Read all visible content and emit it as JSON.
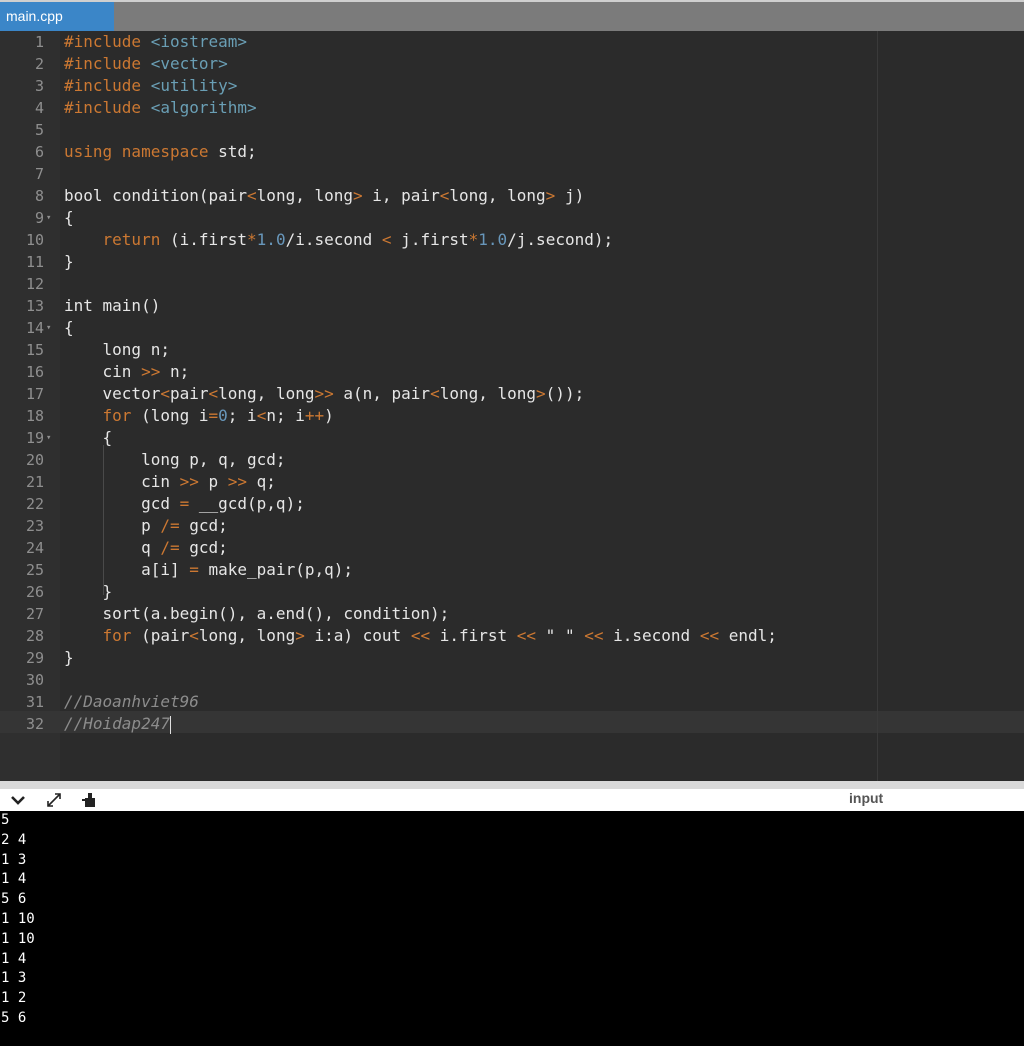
{
  "tab": {
    "label": "main.cpp"
  },
  "editor": {
    "lines": [
      {
        "n": "1",
        "fold": false,
        "tokens": [
          {
            "t": "#include ",
            "c": "kw"
          },
          {
            "t": "<iostream>",
            "c": "str"
          }
        ]
      },
      {
        "n": "2",
        "fold": false,
        "tokens": [
          {
            "t": "#include ",
            "c": "kw"
          },
          {
            "t": "<vector>",
            "c": "str"
          }
        ]
      },
      {
        "n": "3",
        "fold": false,
        "tokens": [
          {
            "t": "#include ",
            "c": "kw"
          },
          {
            "t": "<utility>",
            "c": "str"
          }
        ]
      },
      {
        "n": "4",
        "fold": false,
        "tokens": [
          {
            "t": "#include ",
            "c": "kw"
          },
          {
            "t": "<algorithm>",
            "c": "str"
          }
        ]
      },
      {
        "n": "5",
        "fold": false,
        "tokens": []
      },
      {
        "n": "6",
        "fold": false,
        "tokens": [
          {
            "t": "using ",
            "c": "kw"
          },
          {
            "t": "namespace ",
            "c": "kw"
          },
          {
            "t": "std;",
            "c": ""
          }
        ]
      },
      {
        "n": "7",
        "fold": false,
        "tokens": []
      },
      {
        "n": "8",
        "fold": false,
        "tokens": [
          {
            "t": "bool condition(pair",
            "c": ""
          },
          {
            "t": "<",
            "c": "op"
          },
          {
            "t": "long, long",
            "c": ""
          },
          {
            "t": ">",
            "c": "op"
          },
          {
            "t": " i, pair",
            "c": ""
          },
          {
            "t": "<",
            "c": "op"
          },
          {
            "t": "long, long",
            "c": ""
          },
          {
            "t": ">",
            "c": "op"
          },
          {
            "t": " j)",
            "c": ""
          }
        ]
      },
      {
        "n": "9",
        "fold": true,
        "tokens": [
          {
            "t": "{",
            "c": ""
          }
        ]
      },
      {
        "n": "10",
        "fold": false,
        "tokens": [
          {
            "t": "    ",
            "c": ""
          },
          {
            "t": "return",
            "c": "kw"
          },
          {
            "t": " (i.first",
            "c": ""
          },
          {
            "t": "*",
            "c": "op"
          },
          {
            "t": "1.0",
            "c": "num"
          },
          {
            "t": "/i.second ",
            "c": ""
          },
          {
            "t": "<",
            "c": "op"
          },
          {
            "t": " j.first",
            "c": ""
          },
          {
            "t": "*",
            "c": "op"
          },
          {
            "t": "1.0",
            "c": "num"
          },
          {
            "t": "/j.second);",
            "c": ""
          }
        ]
      },
      {
        "n": "11",
        "fold": false,
        "tokens": [
          {
            "t": "}",
            "c": ""
          }
        ]
      },
      {
        "n": "12",
        "fold": false,
        "tokens": []
      },
      {
        "n": "13",
        "fold": false,
        "tokens": [
          {
            "t": "int main()",
            "c": ""
          }
        ]
      },
      {
        "n": "14",
        "fold": true,
        "tokens": [
          {
            "t": "{",
            "c": ""
          }
        ]
      },
      {
        "n": "15",
        "fold": false,
        "tokens": [
          {
            "t": "    long n;",
            "c": ""
          }
        ]
      },
      {
        "n": "16",
        "fold": false,
        "tokens": [
          {
            "t": "    cin ",
            "c": ""
          },
          {
            "t": ">>",
            "c": "op"
          },
          {
            "t": " n;",
            "c": ""
          }
        ]
      },
      {
        "n": "17",
        "fold": false,
        "tokens": [
          {
            "t": "    vector",
            "c": ""
          },
          {
            "t": "<",
            "c": "op"
          },
          {
            "t": "pair",
            "c": ""
          },
          {
            "t": "<",
            "c": "op"
          },
          {
            "t": "long, long",
            "c": ""
          },
          {
            "t": ">>",
            "c": "op"
          },
          {
            "t": " a(n, pair",
            "c": ""
          },
          {
            "t": "<",
            "c": "op"
          },
          {
            "t": "long, long",
            "c": ""
          },
          {
            "t": ">",
            "c": "op"
          },
          {
            "t": "());",
            "c": ""
          }
        ]
      },
      {
        "n": "18",
        "fold": false,
        "tokens": [
          {
            "t": "    ",
            "c": ""
          },
          {
            "t": "for",
            "c": "kw"
          },
          {
            "t": " (long i",
            "c": ""
          },
          {
            "t": "=",
            "c": "op"
          },
          {
            "t": "0",
            "c": "num"
          },
          {
            "t": "; i",
            "c": ""
          },
          {
            "t": "<",
            "c": "op"
          },
          {
            "t": "n; i",
            "c": ""
          },
          {
            "t": "++",
            "c": "op"
          },
          {
            "t": ")",
            "c": ""
          }
        ]
      },
      {
        "n": "19",
        "fold": true,
        "tokens": [
          {
            "t": "    {",
            "c": ""
          }
        ]
      },
      {
        "n": "20",
        "fold": false,
        "tokens": [
          {
            "t": "        long p, q, gcd;",
            "c": ""
          }
        ]
      },
      {
        "n": "21",
        "fold": false,
        "tokens": [
          {
            "t": "        cin ",
            "c": ""
          },
          {
            "t": ">>",
            "c": "op"
          },
          {
            "t": " p ",
            "c": ""
          },
          {
            "t": ">>",
            "c": "op"
          },
          {
            "t": " q;",
            "c": ""
          }
        ]
      },
      {
        "n": "22",
        "fold": false,
        "tokens": [
          {
            "t": "        gcd ",
            "c": ""
          },
          {
            "t": "=",
            "c": "op"
          },
          {
            "t": " __gcd(p,q);",
            "c": ""
          }
        ]
      },
      {
        "n": "23",
        "fold": false,
        "tokens": [
          {
            "t": "        p ",
            "c": ""
          },
          {
            "t": "/=",
            "c": "op"
          },
          {
            "t": " gcd;",
            "c": ""
          }
        ]
      },
      {
        "n": "24",
        "fold": false,
        "tokens": [
          {
            "t": "        q ",
            "c": ""
          },
          {
            "t": "/=",
            "c": "op"
          },
          {
            "t": " gcd;",
            "c": ""
          }
        ]
      },
      {
        "n": "25",
        "fold": false,
        "tokens": [
          {
            "t": "        a[i] ",
            "c": ""
          },
          {
            "t": "=",
            "c": "op"
          },
          {
            "t": " make_pair(p,q);",
            "c": ""
          }
        ]
      },
      {
        "n": "26",
        "fold": false,
        "tokens": [
          {
            "t": "    }",
            "c": ""
          }
        ]
      },
      {
        "n": "27",
        "fold": false,
        "tokens": [
          {
            "t": "    sort(a.begin(), a.end(), condition);",
            "c": ""
          }
        ]
      },
      {
        "n": "28",
        "fold": false,
        "tokens": [
          {
            "t": "    ",
            "c": ""
          },
          {
            "t": "for",
            "c": "kw"
          },
          {
            "t": " (pair",
            "c": ""
          },
          {
            "t": "<",
            "c": "op"
          },
          {
            "t": "long, long",
            "c": ""
          },
          {
            "t": ">",
            "c": "op"
          },
          {
            "t": " i:a) cout ",
            "c": ""
          },
          {
            "t": "<<",
            "c": "op"
          },
          {
            "t": " i.first ",
            "c": ""
          },
          {
            "t": "<<",
            "c": "op"
          },
          {
            "t": " \" \" ",
            "c": ""
          },
          {
            "t": "<<",
            "c": "op"
          },
          {
            "t": " i.second ",
            "c": ""
          },
          {
            "t": "<<",
            "c": "op"
          },
          {
            "t": " endl;",
            "c": ""
          }
        ]
      },
      {
        "n": "29",
        "fold": false,
        "tokens": [
          {
            "t": "}",
            "c": ""
          }
        ]
      },
      {
        "n": "30",
        "fold": false,
        "tokens": []
      },
      {
        "n": "31",
        "fold": false,
        "tokens": [
          {
            "t": "//Daoanhviet96",
            "c": "cmt"
          }
        ]
      },
      {
        "n": "32",
        "fold": false,
        "tokens": [
          {
            "t": "//Hoidap247",
            "c": "cmt"
          }
        ],
        "cursor": true
      }
    ]
  },
  "console": {
    "collapse_icon": "chevron-down-icon",
    "expand_icon": "expand-icon",
    "clear_icon": "clear-icon",
    "input_label": "input",
    "output_lines": [
      "5",
      "2 4",
      "1 3",
      "1 4",
      "5 6",
      "1 10",
      "1 10",
      "1 4",
      "1 3",
      "1 2",
      "5 6"
    ]
  },
  "colors": {
    "keyword": "#cc7832",
    "string": "#6a9fb5",
    "number": "#6897bb",
    "tab_active": "#3b86c8",
    "editor_bg": "#2b2b2b"
  }
}
